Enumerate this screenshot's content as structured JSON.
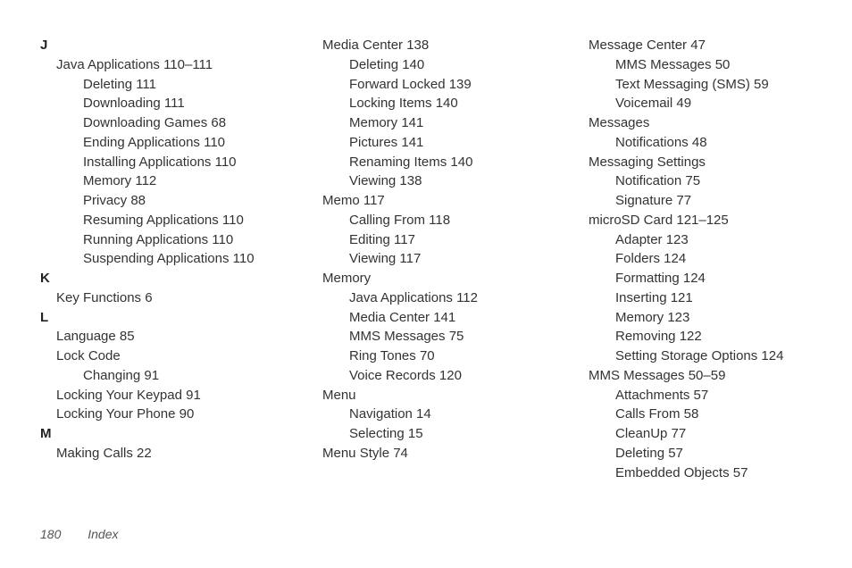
{
  "col1": {
    "letter_j": "J",
    "j0": "Java Applications 110–111",
    "j1": "Deleting 111",
    "j2": "Downloading 111",
    "j3": "Downloading Games 68",
    "j4": "Ending Applications 110",
    "j5": "Installing Applications 110",
    "j6": "Memory 112",
    "j7": "Privacy 88",
    "j8": "Resuming Applications 110",
    "j9": "Running Applications 110",
    "j10": "Suspending Applications 110",
    "letter_k": "K",
    "k0": "Key Functions 6",
    "letter_l": "L",
    "l0": "Language 85",
    "l1": "Lock Code",
    "l2": "Changing 91",
    "l3": "Locking Your Keypad 91",
    "l4": "Locking Your Phone 90",
    "letter_m": "M",
    "m0": "Making Calls 22"
  },
  "col2": {
    "e0": "Media Center 138",
    "e1": "Deleting 140",
    "e2": "Forward Locked 139",
    "e3": "Locking Items 140",
    "e4": "Memory 141",
    "e5": "Pictures 141",
    "e6": "Renaming Items 140",
    "e7": "Viewing 138",
    "e8": "Memo 117",
    "e9": "Calling From 118",
    "e10": "Editing 117",
    "e11": "Viewing 117",
    "e12": "Memory",
    "e13": "Java Applications 112",
    "e14": "Media Center 141",
    "e15": "MMS Messages 75",
    "e16": "Ring Tones 70",
    "e17": "Voice Records 120",
    "e18": "Menu",
    "e19": "Navigation 14",
    "e20": "Selecting 15",
    "e21": "Menu Style 74"
  },
  "col3": {
    "e0": "Message Center 47",
    "e1": "MMS Messages 50",
    "e2": "Text Messaging (SMS) 59",
    "e3": "Voicemail 49",
    "e4": "Messages",
    "e5": "Notifications 48",
    "e6": "Messaging Settings",
    "e7": "Notification 75",
    "e8": "Signature 77",
    "e9": "microSD Card 121–125",
    "e10": "Adapter 123",
    "e11": "Folders 124",
    "e12": "Formatting 124",
    "e13": "Inserting 121",
    "e14": "Memory 123",
    "e15": "Removing 122",
    "e16": "Setting Storage Options 124",
    "e17": "MMS Messages 50–59",
    "e18": "Attachments 57",
    "e19": "Calls From 58",
    "e20": "CleanUp 77",
    "e21": "Deleting 57",
    "e22": "Embedded Objects 57"
  },
  "footer": {
    "page": "180",
    "section": "Index"
  }
}
